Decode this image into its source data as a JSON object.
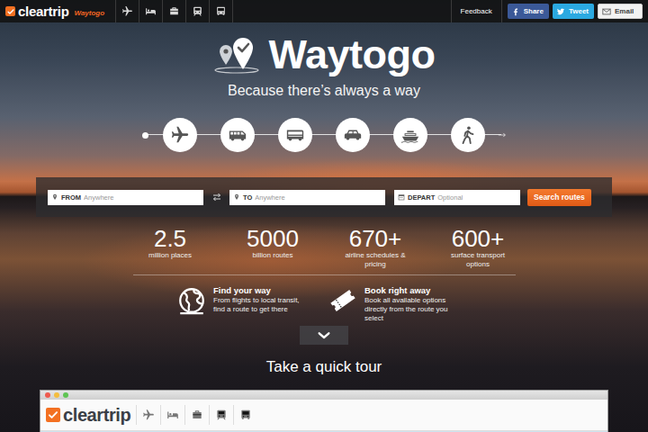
{
  "topbar": {
    "brand": "cleartrip",
    "sub_brand": "Waytogo",
    "feedback": "Feedback",
    "share_buttons": [
      {
        "label": "Share"
      },
      {
        "label": "Tweet"
      },
      {
        "label": "Email"
      }
    ]
  },
  "hero": {
    "title": "Waytogo",
    "tagline": "Because there’s always a way"
  },
  "search": {
    "from": {
      "label": "FROM",
      "placeholder": "Anywhere"
    },
    "to": {
      "label": "TO",
      "placeholder": "Anywhere"
    },
    "depart": {
      "label": "DEPART",
      "placeholder": "Optional"
    },
    "button": "Search routes"
  },
  "stats": [
    {
      "value": "2.5",
      "label": "million places"
    },
    {
      "value": "5000",
      "label": "billion routes"
    },
    {
      "value": "670+",
      "label": "airline schedules & pricing"
    },
    {
      "value": "600+",
      "label": "surface transport options"
    }
  ],
  "features": [
    {
      "title": "Find your way",
      "text": "From flights to local transit, find a route to get there"
    },
    {
      "title": "Book right away",
      "text": "Book all available options directly from the route you select"
    }
  ],
  "tour": {
    "title": "Take a quick tour",
    "preview_brand": "cleartrip"
  }
}
